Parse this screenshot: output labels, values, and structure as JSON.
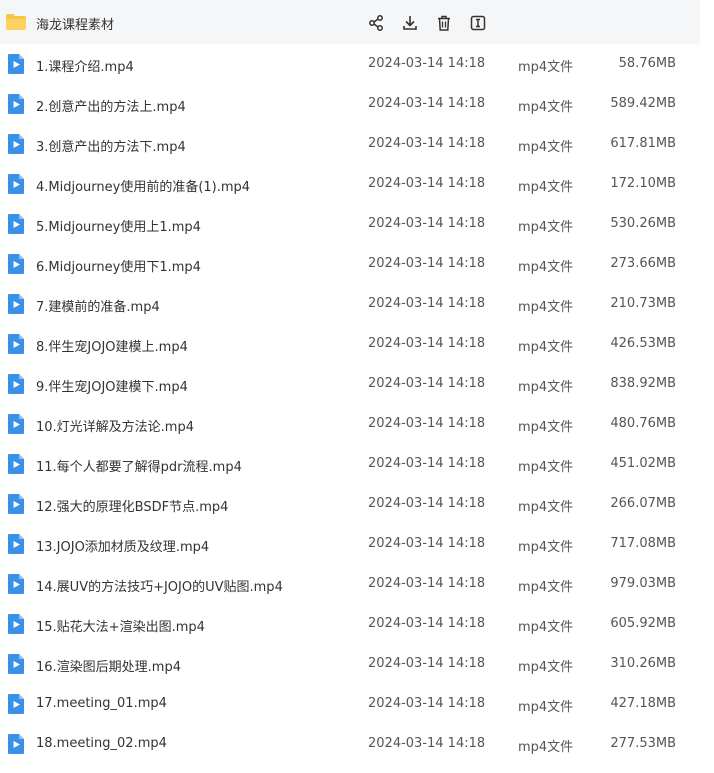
{
  "header": {
    "folder_name": "海龙课程素材",
    "icons": [
      "share-icon",
      "download-icon",
      "delete-icon",
      "rename-icon"
    ]
  },
  "colors": {
    "accent": "#3a8fe6",
    "folder": "#f7c548",
    "header_bg": "#f5f6f8"
  },
  "files": [
    {
      "name": "1.课程介绍.mp4",
      "date": "2024-03-14 14:18",
      "type": "mp4文件",
      "size": "58.76MB"
    },
    {
      "name": "2.创意产出的方法上.mp4",
      "date": "2024-03-14 14:18",
      "type": "mp4文件",
      "size": "589.42MB"
    },
    {
      "name": "3.创意产出的方法下.mp4",
      "date": "2024-03-14 14:18",
      "type": "mp4文件",
      "size": "617.81MB"
    },
    {
      "name": "4.Midjourney使用前的准备(1).mp4",
      "date": "2024-03-14 14:18",
      "type": "mp4文件",
      "size": "172.10MB"
    },
    {
      "name": "5.Midjourney使用上1.mp4",
      "date": "2024-03-14 14:18",
      "type": "mp4文件",
      "size": "530.26MB"
    },
    {
      "name": "6.Midjourney使用下1.mp4",
      "date": "2024-03-14 14:18",
      "type": "mp4文件",
      "size": "273.66MB"
    },
    {
      "name": "7.建模前的准备.mp4",
      "date": "2024-03-14 14:18",
      "type": "mp4文件",
      "size": "210.73MB"
    },
    {
      "name": "8.伴生宠JOJO建模上.mp4",
      "date": "2024-03-14 14:18",
      "type": "mp4文件",
      "size": "426.53MB"
    },
    {
      "name": "9.伴生宠JOJO建模下.mp4",
      "date": "2024-03-14 14:18",
      "type": "mp4文件",
      "size": "838.92MB"
    },
    {
      "name": "10.灯光详解及方法论.mp4",
      "date": "2024-03-14 14:18",
      "type": "mp4文件",
      "size": "480.76MB"
    },
    {
      "name": "11.每个人都要了解得pdr流程.mp4",
      "date": "2024-03-14 14:18",
      "type": "mp4文件",
      "size": "451.02MB"
    },
    {
      "name": "12.强大的原理化BSDF节点.mp4",
      "date": "2024-03-14 14:18",
      "type": "mp4文件",
      "size": "266.07MB"
    },
    {
      "name": "13.JOJO添加材质及纹理.mp4",
      "date": "2024-03-14 14:18",
      "type": "mp4文件",
      "size": "717.08MB"
    },
    {
      "name": "14.展UV的方法技巧+JOJO的UV贴图.mp4",
      "date": "2024-03-14 14:18",
      "type": "mp4文件",
      "size": "979.03MB"
    },
    {
      "name": "15.贴花大法+渲染出图.mp4",
      "date": "2024-03-14 14:18",
      "type": "mp4文件",
      "size": "605.92MB"
    },
    {
      "name": "16.渲染图后期处理.mp4",
      "date": "2024-03-14 14:18",
      "type": "mp4文件",
      "size": "310.26MB"
    },
    {
      "name": "17.meeting_01.mp4",
      "date": "2024-03-14 14:18",
      "type": "mp4文件",
      "size": "427.18MB"
    },
    {
      "name": "18.meeting_02.mp4",
      "date": "2024-03-14 14:18",
      "type": "mp4文件",
      "size": "277.53MB"
    }
  ]
}
